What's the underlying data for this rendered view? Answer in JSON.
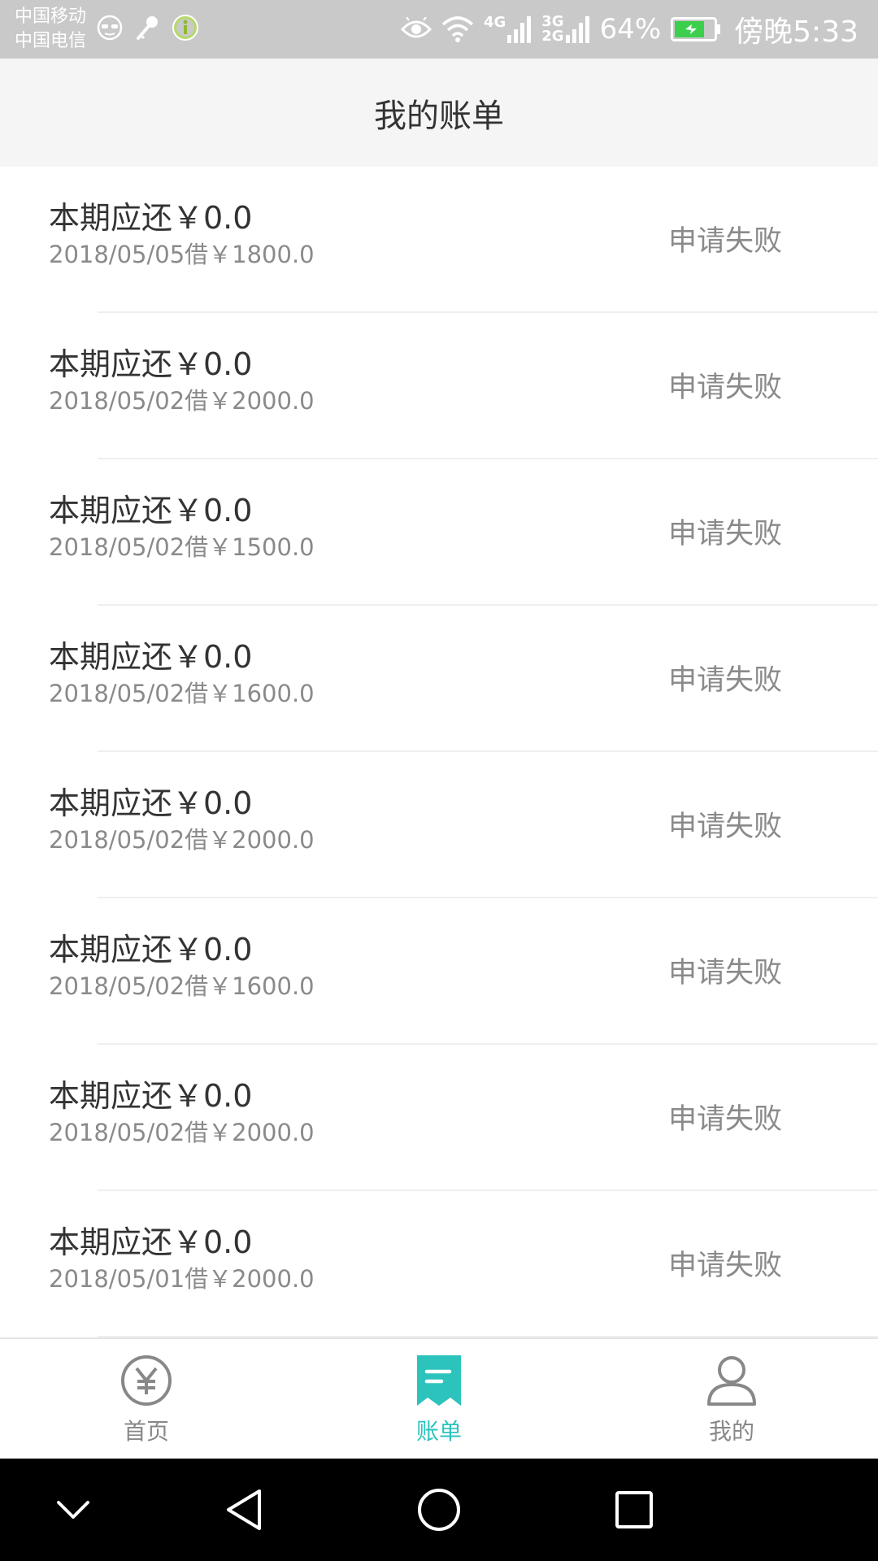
{
  "status_bar": {
    "carrier_1": "中国移动",
    "carrier_2": "中国电信",
    "network_top": "4G",
    "network_3g": "3G",
    "network_2g": "2G",
    "battery": "64%",
    "time": "傍晚5:33"
  },
  "header": {
    "title": "我的账单"
  },
  "bills": [
    {
      "title": "本期应还￥0.0",
      "subtitle": "2018/05/05借￥1800.0",
      "status": "申请失败"
    },
    {
      "title": "本期应还￥0.0",
      "subtitle": "2018/05/02借￥2000.0",
      "status": "申请失败"
    },
    {
      "title": "本期应还￥0.0",
      "subtitle": "2018/05/02借￥1500.0",
      "status": "申请失败"
    },
    {
      "title": "本期应还￥0.0",
      "subtitle": "2018/05/02借￥1600.0",
      "status": "申请失败"
    },
    {
      "title": "本期应还￥0.0",
      "subtitle": "2018/05/02借￥2000.0",
      "status": "申请失败"
    },
    {
      "title": "本期应还￥0.0",
      "subtitle": "2018/05/02借￥1600.0",
      "status": "申请失败"
    },
    {
      "title": "本期应还￥0.0",
      "subtitle": "2018/05/02借￥2000.0",
      "status": "申请失败"
    },
    {
      "title": "本期应还￥0.0",
      "subtitle": "2018/05/01借￥2000.0",
      "status": "申请失败"
    }
  ],
  "tabs": [
    {
      "label": "首页",
      "icon": "yuan-circle-icon",
      "active": false
    },
    {
      "label": "账单",
      "icon": "bill-icon",
      "active": true
    },
    {
      "label": "我的",
      "icon": "person-icon",
      "active": false
    }
  ],
  "colors": {
    "accent": "#2cc3bd",
    "text_primary": "#333333",
    "text_secondary": "#8a8a8a",
    "header_bg": "#f5f5f5",
    "status_bar_bg": "#c9c9c9"
  }
}
